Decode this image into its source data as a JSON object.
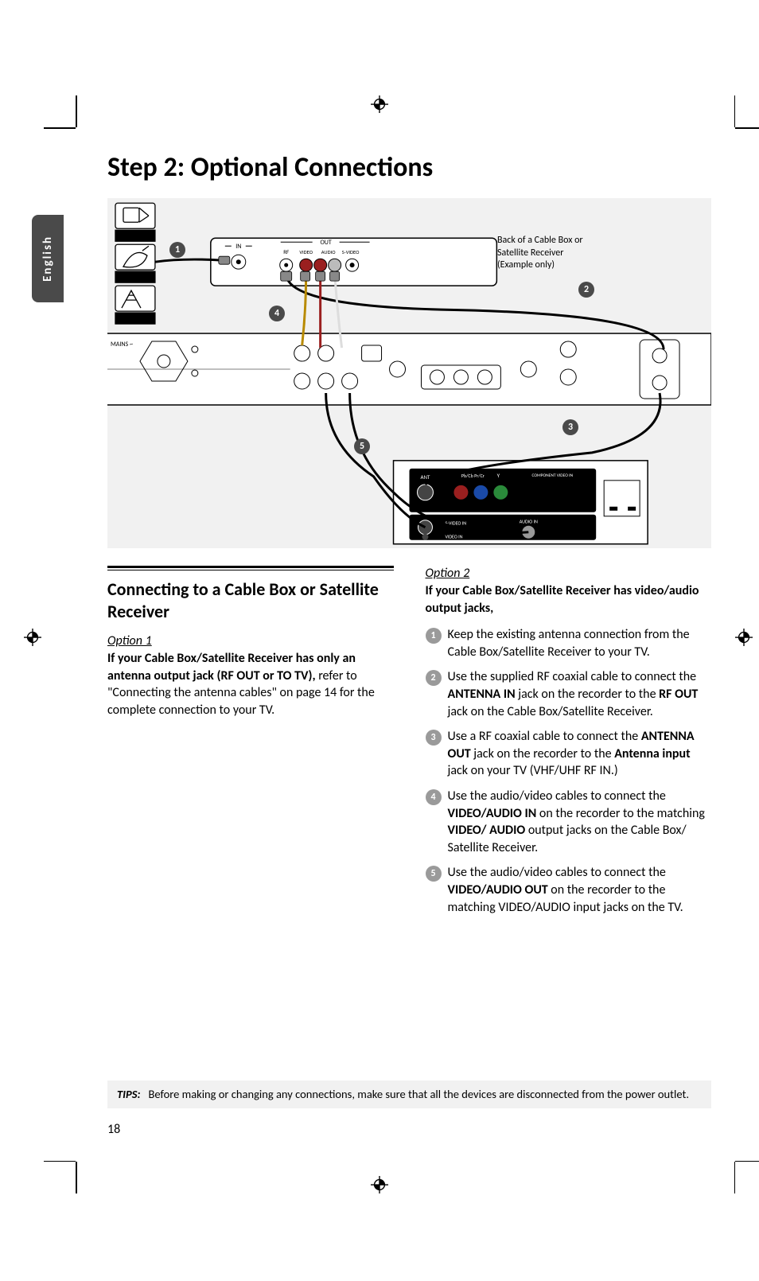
{
  "page_number": "18",
  "language_tab": "English",
  "heading": "Step 2: Optional Connections",
  "figure": {
    "caption": "Back of a Cable Box or Satellite Receiver (Example only)",
    "signal_labels": [
      "CABLE",
      "SATELLITE",
      "ANTENNA"
    ],
    "box_labels": {
      "in": "IN",
      "out": "OUT",
      "rf": "RF",
      "video": "VIDEO",
      "audio": "AUDIO",
      "svideo": "S-VIDEO"
    },
    "tv_labels": {
      "ant": "ANT",
      "pbcr": "Pb/Cb  Pr/Cr",
      "y": "Y",
      "component": "COMPONENT VIDEO IN",
      "svideo_in": "S-VIDEO IN",
      "audio_in": "AUDIO IN",
      "video_in": "VIDEO IN"
    },
    "recorder_mains": "MAINS ~",
    "callouts": [
      "1",
      "2",
      "3",
      "4",
      "5"
    ]
  },
  "section_title": "Connecting to a Cable Box or Satellite Receiver",
  "option1": {
    "label": "Option 1",
    "bold_intro": "If your Cable Box/Satellite Receiver has only an antenna output jack (RF OUT or TO TV),",
    "body": "refer to \"Connecting the antenna cables\" on page 14 for the complete connection to your TV."
  },
  "option2": {
    "label": "Option 2",
    "bold_intro": "If your Cable Box/Satellite Receiver has video/audio output jacks,",
    "steps": [
      {
        "n": "1",
        "text": "Keep the existing antenna connection from the Cable Box/Satellite Receiver to your TV."
      },
      {
        "n": "2",
        "html": "Use the supplied RF coaxial cable to connect the <b>ANTENNA IN</b> jack on the recorder to the <b>RF OUT</b> jack on the Cable Box/Satellite Receiver."
      },
      {
        "n": "3",
        "html": "Use a RF coaxial cable to connect the <b>ANTENNA OUT</b>  jack on the recorder to the <b>Antenna input</b> jack on your TV (VHF/UHF RF IN.)"
      },
      {
        "n": "4",
        "html": "Use the audio/video cables to connect the <b>VIDEO/AUDIO IN</b> on the recorder to the matching <b>VIDEO/ AUDIO</b> output jacks on the Cable Box/ Satellite Receiver."
      },
      {
        "n": "5",
        "html": "Use the audio/video cables to connect the <b>VIDEO/AUDIO OUT</b> on the recorder to the matching VIDEO/AUDIO input jacks on the TV."
      }
    ]
  },
  "tips": {
    "label": "TIPS:",
    "text": "Before making or changing any connections, make sure that all the devices are disconnected from the power outlet."
  }
}
